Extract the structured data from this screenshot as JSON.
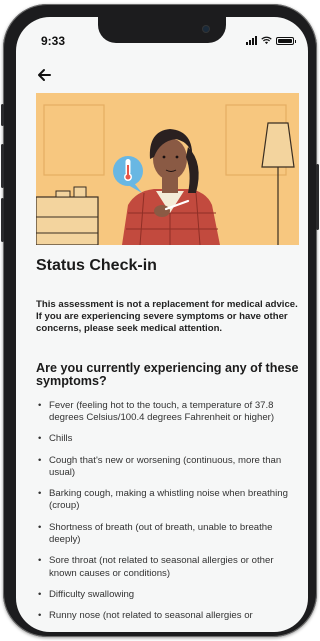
{
  "status_bar": {
    "time": "9:33"
  },
  "header": {
    "back_icon": "arrow-left-icon"
  },
  "hero": {
    "illustration": "person-checking-temperature-illustration",
    "icon": "thermometer-icon"
  },
  "page": {
    "title": "Status Check-in",
    "disclaimer": "This assessment is not a replacement for medical advice. If you are experiencing severe symptoms or have other concerns, please seek medical attention.",
    "question": "Are you currently experiencing any of these symptoms?",
    "symptoms": [
      "Fever (feeling hot to the touch, a temperature of 37.8 degrees Celsius/100.4 degrees Fahrenheit or higher)",
      "Chills",
      "Cough that's new or worsening (continuous, more than usual)",
      "Barking cough, making a whistling noise when breathing (croup)",
      "Shortness of breath (out of breath, unable to breathe deeply)",
      "Sore throat (not related to seasonal allergies or other known causes or conditions)",
      "Difficulty swallowing",
      "Runny nose (not related to seasonal allergies or"
    ]
  },
  "colors": {
    "hero_bg": "#f7c77f",
    "bubble": "#69b7e3",
    "shirt": "#c24a3e",
    "hair": "#2a2020",
    "skin": "#8a5a44"
  }
}
